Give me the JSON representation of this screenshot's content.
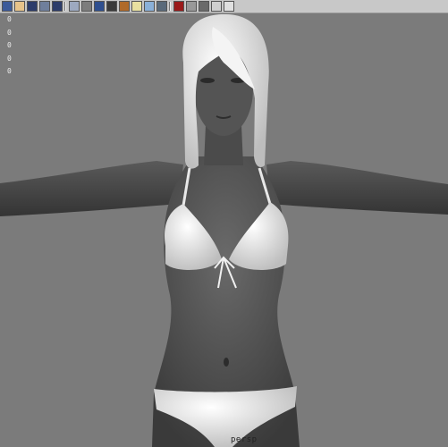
{
  "toolbar": {
    "buttons": [
      {
        "name": "select-tool-icon",
        "color": "#3b5a9a"
      },
      {
        "name": "lasso-tool-icon",
        "color": "#e7c38a"
      },
      {
        "name": "paint-select-icon",
        "color": "#2c3c6a"
      },
      {
        "name": "move-tool-icon",
        "color": "#6f7f9c"
      },
      {
        "name": "rotate-tool-icon",
        "color": "#2c3c6a"
      },
      {
        "name": "camera-view-icon",
        "color": "#9da9c0"
      },
      {
        "name": "wireframe-cube-icon",
        "color": "#7d7d7d"
      },
      {
        "name": "shaded-cube-icon",
        "color": "#2f4f8f"
      },
      {
        "name": "textured-cube-icon",
        "color": "#3a3a3a"
      },
      {
        "name": "material-icon",
        "color": "#b06a2a"
      },
      {
        "name": "light-bulb-icon",
        "color": "#e8e0a0"
      },
      {
        "name": "shadow-cube-icon",
        "color": "#8ab0d8"
      },
      {
        "name": "xray-cube-icon",
        "color": "#5a6a7a"
      },
      {
        "name": "isolate-select-icon",
        "color": "#9a1a1a"
      },
      {
        "name": "joint-xray-icon",
        "color": "#999999"
      },
      {
        "name": "grid-toggle-icon",
        "color": "#6a6a6a"
      },
      {
        "name": "resolution-gate-icon",
        "color": "#cfcfcf"
      },
      {
        "name": "hud-toggle-icon",
        "color": "#e0e0e0"
      }
    ]
  },
  "hud": {
    "values": [
      "0",
      "0",
      "0",
      "0",
      "0"
    ]
  },
  "viewport": {
    "camera_label": "persp",
    "background": "#7b7b7b"
  }
}
